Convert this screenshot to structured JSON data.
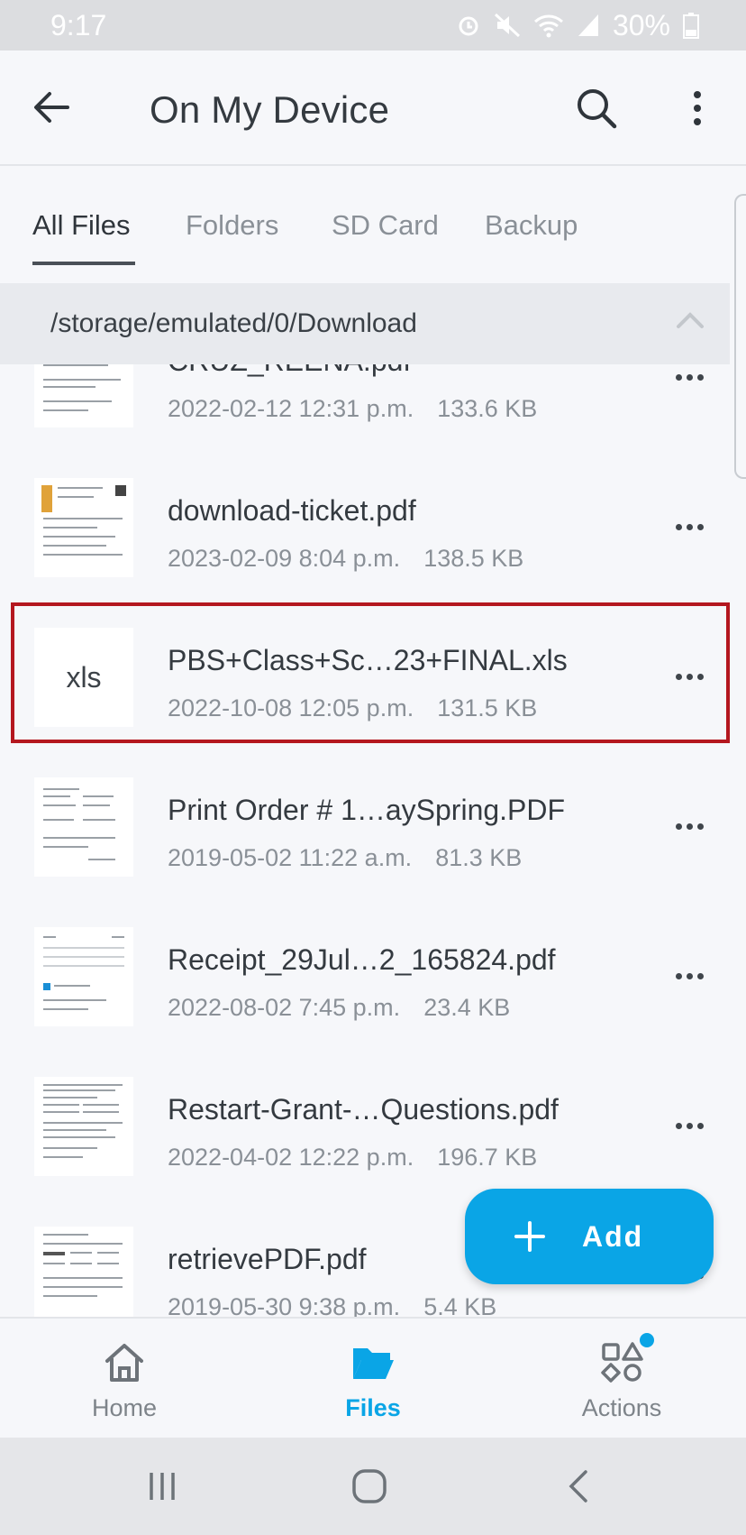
{
  "status_bar": {
    "time": "9:17",
    "battery": "30%"
  },
  "app_bar": {
    "title": "On My Device"
  },
  "tabs": [
    {
      "label": "All Files",
      "active": true
    },
    {
      "label": "Folders",
      "active": false
    },
    {
      "label": "SD Card",
      "active": false
    },
    {
      "label": "Backup",
      "active": false
    }
  ],
  "path": {
    "text": "/storage/emulated/0/Download"
  },
  "files": [
    {
      "name": "CRUZ_REENA.pdf",
      "date": "2022-02-12 12:31 p.m.",
      "size": "133.6 KB",
      "thumb": "pdf"
    },
    {
      "name": "download-ticket.pdf",
      "date": "2023-02-09 8:04 p.m.",
      "size": "138.5 KB",
      "thumb": "pdf"
    },
    {
      "name": "PBS+Class+Sc…23+FINAL.xls",
      "date": "2022-10-08 12:05 p.m.",
      "size": "131.5 KB",
      "thumb": "xls",
      "thumb_label": "xls",
      "highlighted": true
    },
    {
      "name": "Print Order # 1…aySpring.PDF",
      "date": "2019-05-02 11:22 a.m.",
      "size": "81.3 KB",
      "thumb": "pdf"
    },
    {
      "name": "Receipt_29Jul…2_165824.pdf",
      "date": "2022-08-02 7:45 p.m.",
      "size": "23.4 KB",
      "thumb": "pdf"
    },
    {
      "name": "Restart-Grant-…Questions.pdf",
      "date": "2022-04-02 12:22 p.m.",
      "size": "196.7 KB",
      "thumb": "pdf"
    },
    {
      "name": "retrievePDF.pdf",
      "date": "2019-05-30 9:38 p.m.",
      "size": "5.4 KB",
      "thumb": "pdf"
    }
  ],
  "fab": {
    "icon": "plus-icon",
    "label": "Add"
  },
  "bottom_nav": [
    {
      "label": "Home",
      "icon": "home-icon",
      "active": false
    },
    {
      "label": "Files",
      "icon": "folder-open-icon",
      "active": true
    },
    {
      "label": "Actions",
      "icon": "shapes-icon",
      "active": false
    }
  ],
  "system_nav": [
    "recents-icon",
    "home-circle-icon",
    "back-chevron-icon"
  ],
  "colors": {
    "accent": "#0aa5e6",
    "highlight_border": "#b4171f",
    "text_primary": "#343a40",
    "text_secondary": "#8a9097"
  }
}
